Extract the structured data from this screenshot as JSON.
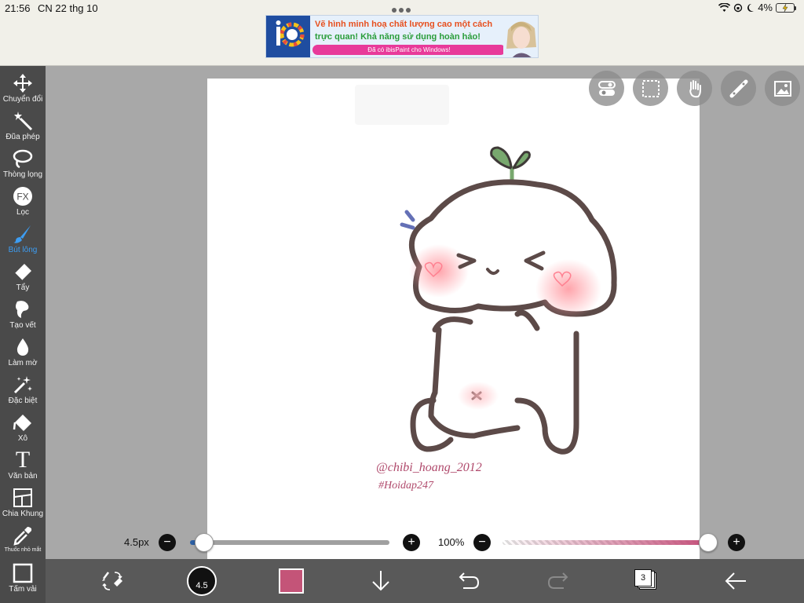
{
  "status_bar": {
    "time": "21:56",
    "date": "CN 22 thg 10",
    "battery_percent": "4%"
  },
  "ad": {
    "line1": "Vẽ hình minh hoạ chất lượng cao một cách",
    "line2": "trực quan! Khả năng sử dụng hoàn hảo!",
    "pill_text": "Đã có ibisPaint cho Windows!",
    "logo_text": "iP"
  },
  "toolbar": {
    "items": [
      {
        "label": "Chuyển đổi",
        "icon": "move-icon"
      },
      {
        "label": "Đũa phép",
        "icon": "magic-wand-icon"
      },
      {
        "label": "Thòng lọng",
        "icon": "lasso-icon"
      },
      {
        "label": "Lọc",
        "icon": "fx-filter-icon",
        "badge": "FX"
      },
      {
        "label": "Bút lông",
        "icon": "brush-icon",
        "active": true
      },
      {
        "label": "Tẩy",
        "icon": "eraser-icon"
      },
      {
        "label": "Tạo vết",
        "icon": "smudge-icon"
      },
      {
        "label": "Làm mờ",
        "icon": "blur-icon"
      },
      {
        "label": "Đặc biệt",
        "icon": "special-icon"
      },
      {
        "label": "Xô",
        "icon": "bucket-icon"
      },
      {
        "label": "Văn bản",
        "icon": "text-icon",
        "glyph": "T"
      },
      {
        "label": "Chia Khung",
        "icon": "frame-divider-icon"
      },
      {
        "label": "Thuốc nhỏ mắt",
        "icon": "eyedropper-icon"
      },
      {
        "label": "Tấm vải",
        "icon": "canvas-icon"
      }
    ]
  },
  "brush_size": {
    "label": "4.5px",
    "fraction": 0.07
  },
  "opacity": {
    "label": "100%",
    "fraction": 1.0
  },
  "bottom_bar": {
    "brush_size_value": "4.5",
    "color": "#c45478",
    "layer_count": "3"
  },
  "artwork": {
    "watermark_line1": "@chibi_hoang_2012",
    "watermark_line2": "#Hoidap247"
  },
  "colors": {
    "accent_blue": "#3d9df2",
    "toolbar_bg": "#4a4a4a",
    "canvas_bg": "#a8a8a8",
    "current_color": "#c45478",
    "sprout_green": "#78a86e",
    "outline_brown": "#5c4a48"
  }
}
